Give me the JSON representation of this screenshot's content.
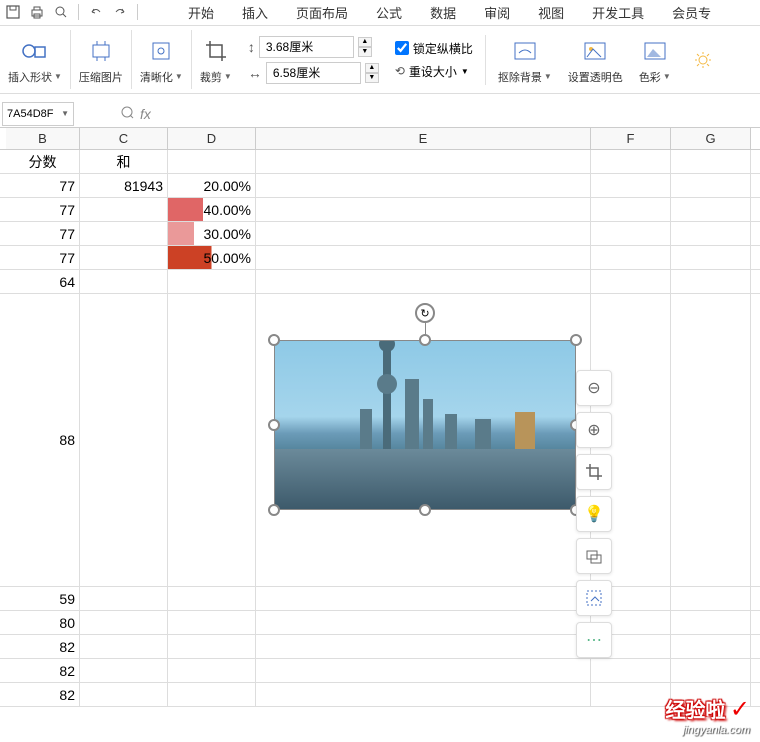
{
  "tabs": {
    "start": "开始",
    "insert": "插入",
    "page_layout": "页面布局",
    "formula": "公式",
    "data": "数据",
    "review": "审阅",
    "view": "视图",
    "dev": "开发工具",
    "member": "会员专"
  },
  "ribbon": {
    "insert_shape": "插入形状",
    "compress": "压缩图片",
    "clarity": "清晰化",
    "crop": "裁剪",
    "height_value": "3.68厘米",
    "width_value": "6.58厘米",
    "lock_ratio": "锁定纵横比",
    "reset_size": "重设大小",
    "remove_bg": "抠除背景",
    "transparency": "设置透明色",
    "color": "色彩"
  },
  "name_box": "7A54D8F",
  "fx": "fx",
  "columns": {
    "B": "B",
    "C": "C",
    "D": "D",
    "E": "E",
    "F": "F",
    "G": "G"
  },
  "headers": {
    "score": "分数",
    "sum": "和"
  },
  "rows": {
    "r1": {
      "b": "77",
      "c": "81943",
      "d": "20.00%"
    },
    "r2": {
      "b": "77",
      "d": "40.00%"
    },
    "r3": {
      "b": "77",
      "d": "30.00%"
    },
    "r4": {
      "b": "77",
      "d": "50.00%"
    },
    "r5": {
      "b": "64"
    },
    "r6": {
      "b": "88"
    },
    "r7": {
      "b": "59"
    },
    "r8": {
      "b": "80"
    },
    "r9": {
      "b": "82"
    },
    "r10": {
      "b": "82"
    },
    "r11": {
      "b": "82"
    }
  },
  "rotate_icon": "↻",
  "watermark": {
    "main": "经验啦",
    "check": "✓",
    "sub": "jingyanla.com"
  }
}
